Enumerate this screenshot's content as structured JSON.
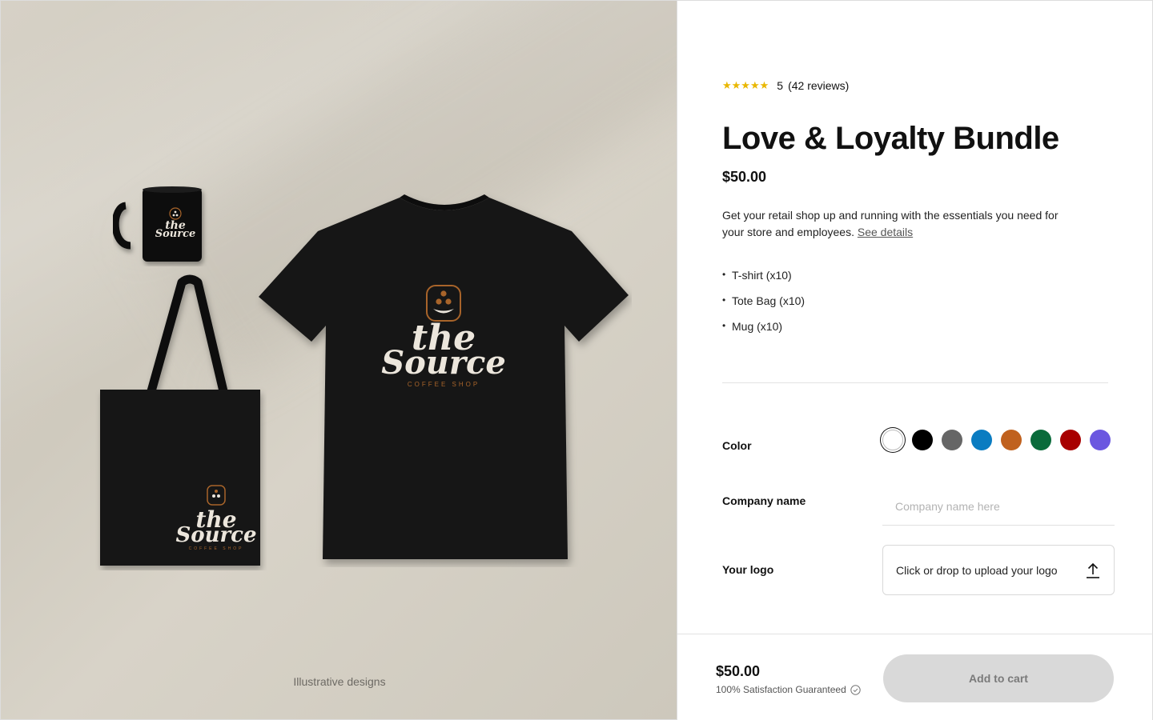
{
  "hero": {
    "caption": "Illustrative designs",
    "logo": {
      "word1": "the",
      "word2": "Source",
      "tagline": "COFFEE SHOP"
    }
  },
  "product": {
    "rating": {
      "stars": "★★★★★",
      "score": "5",
      "reviews": "(42 reviews)"
    },
    "title": "Love & Loyalty Bundle",
    "price": "$50.00",
    "description": "Get your retail shop up and running with the essentials you need for your store and employees.",
    "details_link": "See details",
    "items": [
      "T-shirt (x10)",
      "Tote Bag (x10)",
      "Mug (x10)"
    ]
  },
  "options": {
    "color_label": "Color",
    "colors": [
      "#ffffff",
      "#000000",
      "#666666",
      "#0a7cc1",
      "#c0611e",
      "#0a6b3b",
      "#a80000",
      "#6b57e0"
    ],
    "selected_color": "#ffffff",
    "company_label": "Company name",
    "company_placeholder": "Company name here",
    "company_value": "",
    "logo_label": "Your logo",
    "upload_text": "Click or drop to upload your logo"
  },
  "footer": {
    "price": "$50.00",
    "guarantee": "100% Satisfaction Guaranteed",
    "cart_button": "Add to cart"
  }
}
